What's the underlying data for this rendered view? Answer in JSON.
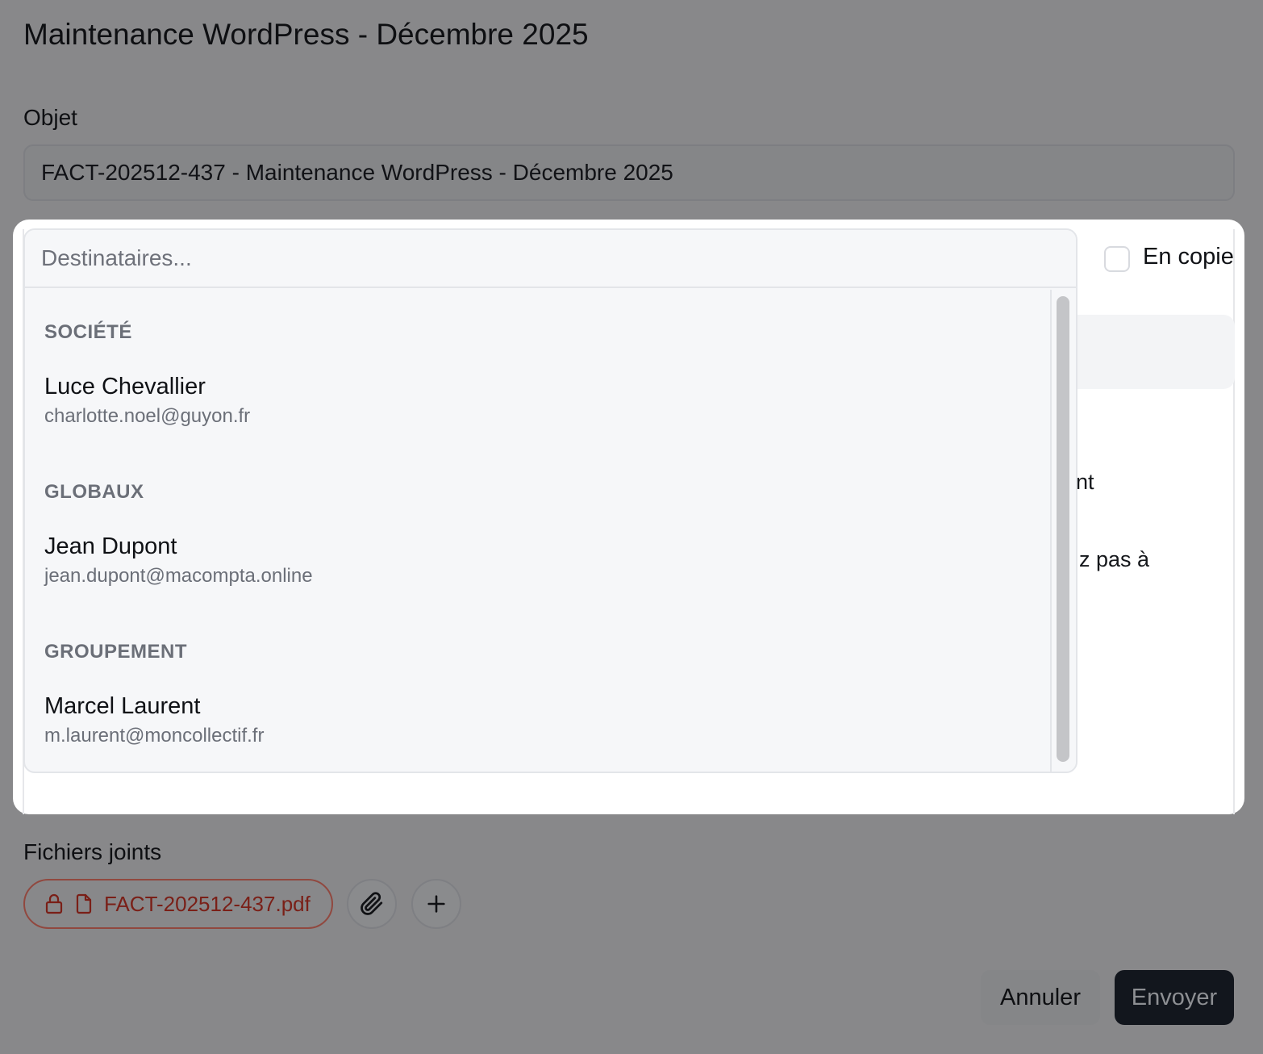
{
  "dialog": {
    "title": "Maintenance WordPress - Décembre 2025",
    "subject_label": "Objet",
    "subject_value": "FACT-202512-437 - Maintenance WordPress - Décembre 2025",
    "body_fragments": [
      "nt",
      "z pas à"
    ],
    "attachments_label": "Fichiers joints",
    "attachment_file": "FACT-202512-437.pdf",
    "cancel_label": "Annuler",
    "send_label": "Envoyer"
  },
  "recipients": {
    "placeholder": "Destinataires...",
    "cc_label": "En copie",
    "groups": [
      {
        "title": "SOCIÉTÉ",
        "name": "Luce Chevallier",
        "email": "charlotte.noel@guyon.fr"
      },
      {
        "title": "GLOBAUX",
        "name": "Jean Dupont",
        "email": "jean.dupont@macompta.online"
      },
      {
        "title": "GROUPEMENT",
        "name": "Marcel Laurent",
        "email": "m.laurent@moncollectif.fr"
      }
    ]
  },
  "colors": {
    "overlay": "#88888a",
    "primary_button": "#12161d",
    "attachment_accent": "#7a1f17"
  },
  "icons": [
    "lock-icon",
    "file-icon",
    "paperclip-icon",
    "plus-icon"
  ]
}
